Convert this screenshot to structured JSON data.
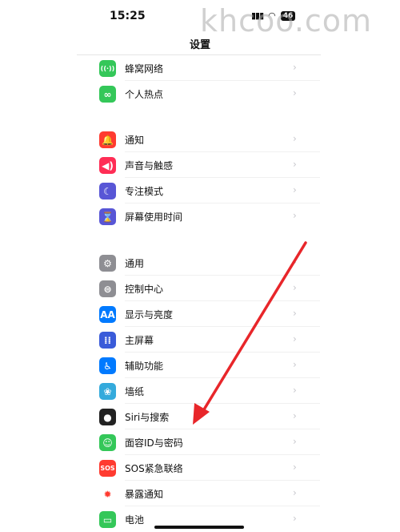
{
  "status_bar": {
    "time": "15:25",
    "battery": "46"
  },
  "watermark": "khcoo.com",
  "nav": {
    "title": "设置"
  },
  "groups": [
    [
      {
        "label": "蜂窝网络",
        "icon": "cellular-antenna-icon",
        "color": "#34C759",
        "glyph": "((·))"
      },
      {
        "label": "个人热点",
        "icon": "personal-hotspot-icon",
        "color": "#34C759",
        "glyph": "∞"
      }
    ],
    [
      {
        "label": "通知",
        "icon": "notification-bell-icon",
        "color": "#FF3B30",
        "glyph": "🔔"
      },
      {
        "label": "声音与触感",
        "icon": "speaker-icon",
        "color": "#FF2D55",
        "glyph": "◀)"
      },
      {
        "label": "专注模式",
        "icon": "moon-icon",
        "color": "#5856D6",
        "glyph": "☾"
      },
      {
        "label": "屏幕使用时间",
        "icon": "hourglass-icon",
        "color": "#5856D6",
        "glyph": "⌛"
      }
    ],
    [
      {
        "label": "通用",
        "icon": "gear-icon",
        "color": "#8E8E93",
        "glyph": "⚙"
      },
      {
        "label": "控制中心",
        "icon": "toggles-icon",
        "color": "#8E8E93",
        "glyph": "⊜"
      },
      {
        "label": "显示与亮度",
        "icon": "text-size-icon",
        "color": "#007AFF",
        "glyph": "AA"
      },
      {
        "label": "主屏幕",
        "icon": "home-grid-icon",
        "color": "#3A5BD9",
        "glyph": "⁞⁞"
      },
      {
        "label": "辅助功能",
        "icon": "accessibility-icon",
        "color": "#007AFF",
        "glyph": "♿"
      },
      {
        "label": "墙纸",
        "icon": "wallpaper-flower-icon",
        "color": "#34AADC",
        "glyph": "❀"
      },
      {
        "label": "Siri与搜索",
        "icon": "siri-icon",
        "color": "#222222",
        "glyph": "●"
      },
      {
        "label": "面容ID与密码",
        "icon": "face-id-icon",
        "color": "#34C759",
        "glyph": "☺"
      },
      {
        "label": "SOS紧急联络",
        "icon": "sos-icon",
        "color": "#FF3B30",
        "glyph": "SOS"
      },
      {
        "label": "暴露通知",
        "icon": "exposure-notification-icon",
        "color": "#FFFFFF",
        "glyph": "✹",
        "glyph_color": "#FF3B30"
      },
      {
        "label": "电池",
        "icon": "battery-icon",
        "color": "#34C759",
        "glyph": "▭"
      }
    ]
  ]
}
